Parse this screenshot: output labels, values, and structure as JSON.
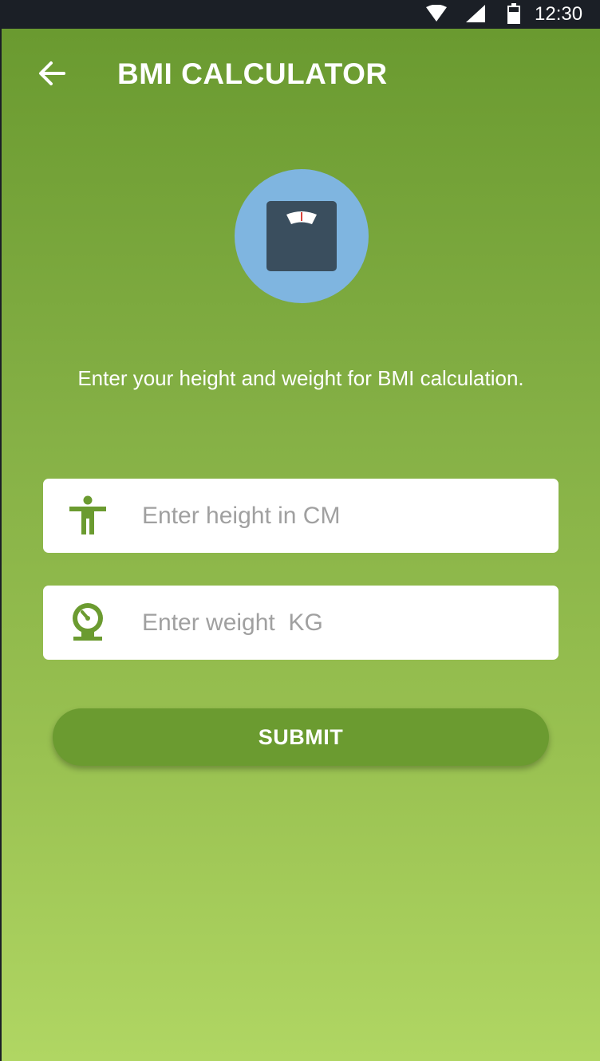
{
  "status_bar": {
    "time": "12:30",
    "icons": [
      "wifi-icon",
      "signal-icon",
      "battery-icon"
    ]
  },
  "toolbar": {
    "back_icon": "arrow-left-icon",
    "title": "BMI CALCULATOR"
  },
  "hero": {
    "icon": "weight-scale-icon",
    "circle_color": "#7fb5e0"
  },
  "instruction": "Enter your height and weight for BMI calculation.",
  "form": {
    "height": {
      "icon": "person-standing-icon",
      "placeholder": "Enter height in CM",
      "value": ""
    },
    "weight": {
      "icon": "speedometer-scale-icon",
      "placeholder": "Enter weight  KG",
      "value": ""
    },
    "submit_label": "SUBMIT"
  },
  "colors": {
    "accent": "#6b9b30",
    "gradient_top": "#6a9a30",
    "gradient_bottom": "#b0d663",
    "icon_green": "#6b9b30",
    "scale_body": "#3a4e5e"
  }
}
